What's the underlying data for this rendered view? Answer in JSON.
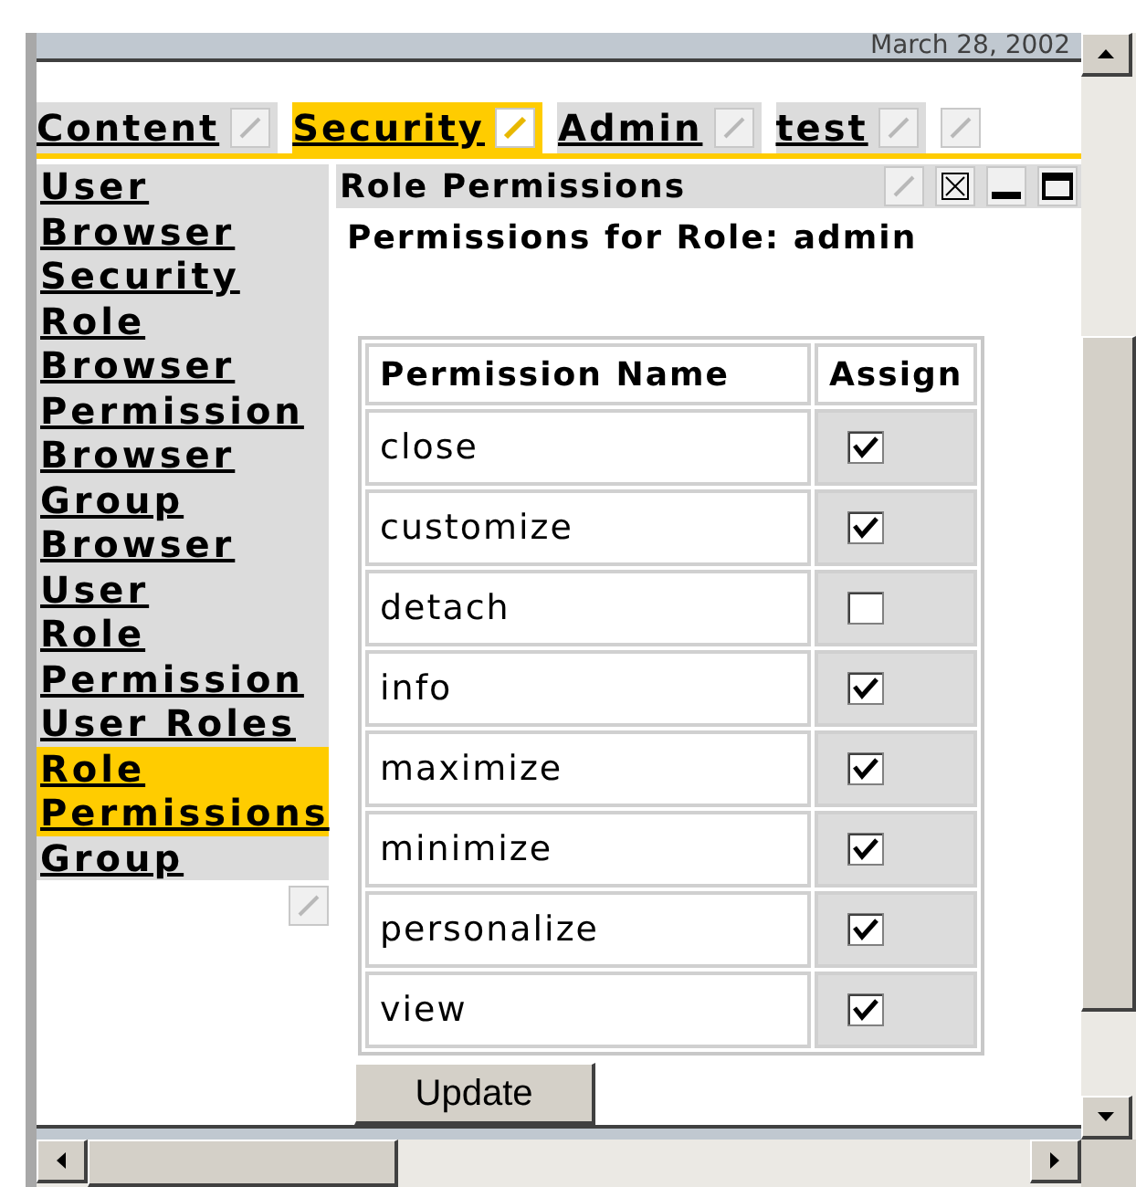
{
  "header": {
    "date": "March 28, 2002"
  },
  "tabs": [
    {
      "label": "Content",
      "selected": false
    },
    {
      "label": "Security",
      "selected": true
    },
    {
      "label": "Admin",
      "selected": false
    },
    {
      "label": "test",
      "selected": false
    }
  ],
  "sidebar": {
    "items": [
      {
        "label": "User Browser",
        "selected": false
      },
      {
        "label": "Security Role Browser",
        "selected": false
      },
      {
        "label": "Permission Browser",
        "selected": false
      },
      {
        "label": "Group Browser",
        "selected": false
      },
      {
        "label": "User",
        "selected": false
      },
      {
        "label": "Role",
        "selected": false
      },
      {
        "label": "Permission",
        "selected": false
      },
      {
        "label": "User Roles",
        "selected": false
      },
      {
        "label": "Role Permissions",
        "selected": true
      },
      {
        "label": "Group",
        "selected": false
      }
    ]
  },
  "portlet": {
    "title": "Role Permissions",
    "subtitle": "Permissions for Role: admin",
    "table": {
      "columns": [
        "Permission Name",
        "Assign"
      ],
      "rows": [
        {
          "name": "close",
          "checked": true
        },
        {
          "name": "customize",
          "checked": true
        },
        {
          "name": "detach",
          "checked": false
        },
        {
          "name": "info",
          "checked": true
        },
        {
          "name": "maximize",
          "checked": true
        },
        {
          "name": "minimize",
          "checked": true
        },
        {
          "name": "personalize",
          "checked": true
        },
        {
          "name": "view",
          "checked": true
        }
      ]
    },
    "button": "Update"
  }
}
